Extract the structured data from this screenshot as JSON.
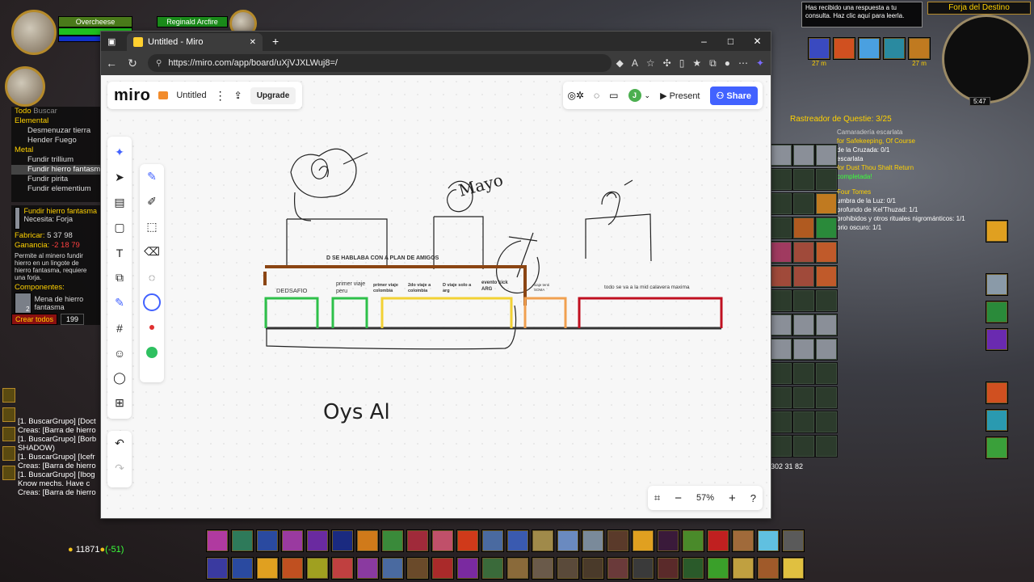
{
  "game": {
    "player_name": "Overcheese",
    "target_name": "Reginald Arcfire",
    "tradeskill": {
      "filter_all": "Todo",
      "search_placeholder": "Buscar",
      "categories": [
        {
          "label": "Elemental",
          "items": [
            "Desmenuzar tierra",
            "Hender Fuego"
          ]
        },
        {
          "label": "Metal",
          "items": [
            "Fundir trillium",
            "Fundir hierro fantasma",
            "Fundir pirita",
            "Fundir elementium"
          ]
        }
      ],
      "selected_recipe": "Fundir hierro fantasma",
      "requires": "Necesita: Forja",
      "craft_label": "Fabricar:",
      "craft_cost": "5 37 98",
      "profit_label": "Ganancia:",
      "profit_value": "-2 18 79",
      "description": "Permite al minero fundir hierro en un lingote de hierro fantasma, requiere una forja.",
      "components_label": "Componentes:",
      "component_name": "Mena de hierro fantasma",
      "component_count": "2",
      "create_all": "Crear todos",
      "create_qty": "199"
    },
    "chat": [
      {
        "prefix": "[1. BuscarGrupo] [Doct",
        "cls": ""
      },
      {
        "prefix": "Creas: [Barra de hierro",
        "cls": "green"
      },
      {
        "prefix": "[1. BuscarGrupo] [Borb",
        "cls": ""
      },
      {
        "prefix": "SHADOW)",
        "cls": ""
      },
      {
        "prefix": "[1. BuscarGrupo] [Icefr",
        "cls": ""
      },
      {
        "prefix": "Creas: [Barra de hierro",
        "cls": "green"
      },
      {
        "prefix": "[1. BuscarGrupo] [Ibog",
        "cls": ""
      },
      {
        "prefix": "Know mechs. Have c",
        "cls": ""
      },
      {
        "prefix": "Creas: [Barra de hierro",
        "cls": "green"
      }
    ],
    "gold": "11871",
    "gold_delta": "(-51)",
    "notification": "Has recibido una respuesta a tu consulta. Haz clic aquí para leerla.",
    "zone_name": "Forja del Destino",
    "clock": "5:47",
    "quest_tracker_title": "Rastreador de Questie: 3/25",
    "quest_lines": [
      "Camaradería escarlata",
      "for Safekeeping, Of Course",
      "de la Cruzada: 0/1",
      "escarlata",
      "for Dust Thou Shalt Return",
      "completada!",
      "Four Tomes",
      "umbra de la Luz: 0/1",
      "profundo de Kel'Thuzad: 1/1",
      "prohibidos y otros rituales nigrománticos: 1/1",
      "orio oscuro: 1/1"
    ],
    "buff_timers": [
      "27 m",
      "27 m"
    ],
    "bag_counts": "302 31 82",
    "bag_stack": "20"
  },
  "browser": {
    "tab_title": "Untitled - Miro",
    "new_tab": "+",
    "url": "https://miro.com/app/board/uXjVJXLWuj8=/",
    "win_minimize": "–",
    "win_maximize": "□",
    "win_close": "✕"
  },
  "miro": {
    "logo": "miro",
    "board_name": "Untitled",
    "upgrade": "Upgrade",
    "present": "Present",
    "share": "Share",
    "avatar_initial": "J",
    "zoom": "57%",
    "canvas": {
      "header": "D SE HABLABA  CON A PLAN DE AMIGOS",
      "labels": [
        "DEDSAFIO",
        "primer viaje peru",
        "primer viaje colombia",
        "2do viaje a colombia",
        "D viaje solo a arg",
        "evento kick ARG",
        "viaje tenti SOMA",
        "todo se va a la mid calavera maxima"
      ],
      "handwriting": [
        "Mayo",
        "Oys  Al"
      ]
    }
  }
}
